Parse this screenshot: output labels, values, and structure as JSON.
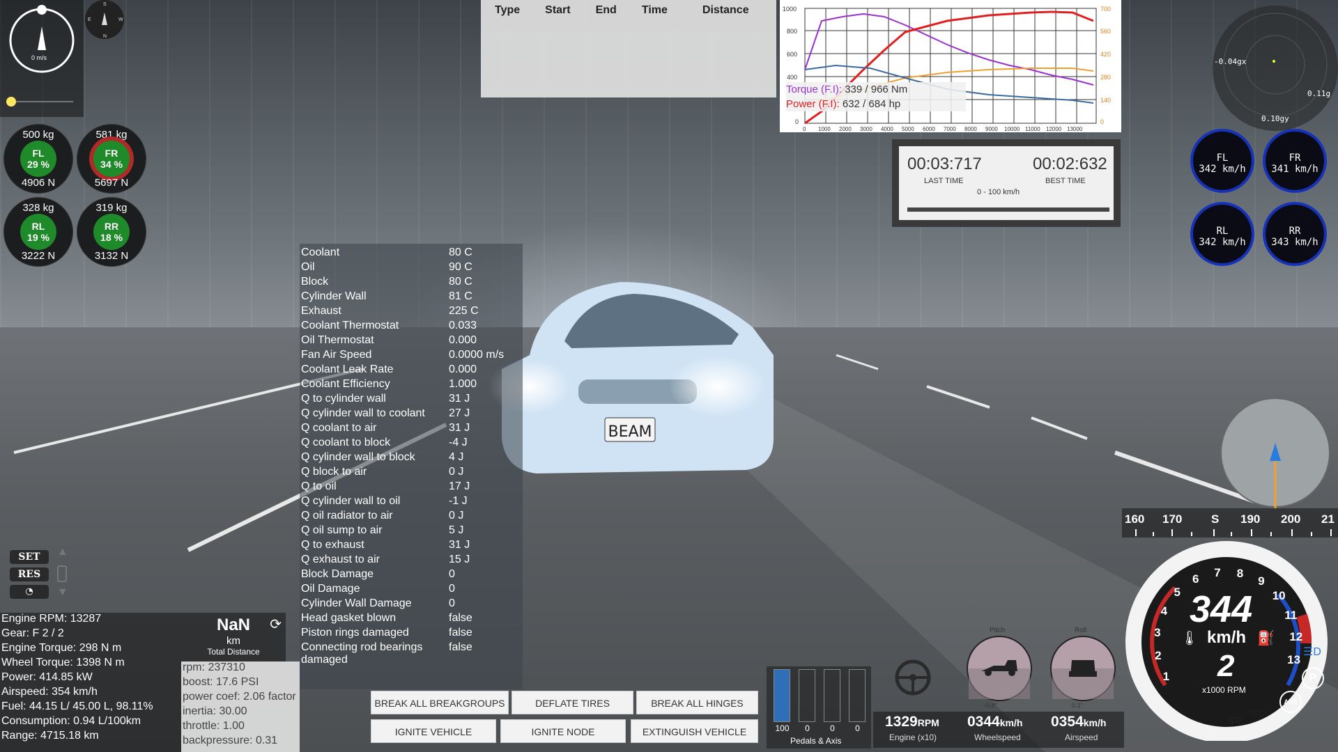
{
  "compass": {
    "speed": "0 m/s"
  },
  "tires": [
    {
      "id": "FL",
      "kg": "500 kg",
      "pct": "29 %",
      "n": "4906 N",
      "color": "#1f8a2a"
    },
    {
      "id": "FR",
      "kg": "581 kg",
      "pct": "34 %",
      "n": "5697 N",
      "color": "#c0302a"
    },
    {
      "id": "RL",
      "kg": "328 kg",
      "pct": "19 %",
      "n": "3222 N",
      "color": "#1f8a2a"
    },
    {
      "id": "RR",
      "kg": "319 kg",
      "pct": "18 %",
      "n": "3132 N",
      "color": "#1f8a2a"
    }
  ],
  "log": {
    "headers": [
      "Type",
      "Start",
      "End",
      "Time",
      "Distance"
    ]
  },
  "graph": {
    "torque_label": "Torque (F.I):",
    "torque_value": "339 / 966 Nm",
    "power_label": "Power (F.I):",
    "power_value": "632 / 684 hp",
    "left_ticks": [
      "1000",
      "800",
      "600",
      "400",
      "0"
    ],
    "right_ticks": [
      "700",
      "560",
      "420",
      "280",
      "140",
      "0"
    ],
    "x_ticks": [
      "0",
      "1000",
      "2000",
      "3000",
      "4000",
      "5000",
      "6000",
      "7000",
      "8000",
      "9000",
      "10000",
      "11000",
      "12000",
      "13000"
    ]
  },
  "timer": {
    "last": "00:03:717",
    "last_label": "LAST TIME",
    "best": "00:02:632",
    "best_label": "BEST TIME",
    "category": "0 - 100 km/h"
  },
  "gforce": {
    "x": "-0.04gx",
    "y": "0.10gy",
    "z": "0.11g"
  },
  "wheels": [
    {
      "id": "FL",
      "speed": "342 km/h"
    },
    {
      "id": "FR",
      "speed": "341 km/h"
    },
    {
      "id": "RL",
      "speed": "342 km/h"
    },
    {
      "id": "RR",
      "speed": "343 km/h"
    }
  ],
  "thermal": [
    [
      "Coolant",
      "80 C"
    ],
    [
      "Oil",
      "90 C"
    ],
    [
      "Block",
      "80 C"
    ],
    [
      "Cylinder Wall",
      "81 C"
    ],
    [
      "Exhaust",
      "225 C"
    ],
    [
      "Coolant Thermostat",
      "0.033"
    ],
    [
      "Oil Thermostat",
      "0.000"
    ],
    [
      "Fan Air Speed",
      "0.0000 m/s"
    ],
    [
      "Coolant Leak Rate",
      "0.000"
    ],
    [
      "Coolant Efficiency",
      "1.000"
    ],
    [
      "Q to cylinder wall",
      "31 J"
    ],
    [
      "Q cylinder wall to coolant",
      "27 J"
    ],
    [
      "Q coolant to air",
      "31 J"
    ],
    [
      "Q coolant to block",
      "-4 J"
    ],
    [
      "Q cylinder wall to block",
      "4 J"
    ],
    [
      "Q block to air",
      "0 J"
    ],
    [
      "Q to oil",
      "17 J"
    ],
    [
      "Q cylinder wall to oil",
      "-1 J"
    ],
    [
      "Q oil radiator to air",
      "0 J"
    ],
    [
      "Q oil sump to air",
      "5 J"
    ],
    [
      "Q to exhaust",
      "31 J"
    ],
    [
      "Q exhaust to air",
      "15 J"
    ],
    [
      "Block Damage",
      "0"
    ],
    [
      "Oil Damage",
      "0"
    ],
    [
      "Cylinder Wall Damage",
      "0"
    ],
    [
      "Head gasket blown",
      "false"
    ],
    [
      "Piston rings damaged",
      "false"
    ],
    [
      "Connecting rod bearings damaged",
      "false"
    ]
  ],
  "stats": [
    "Engine RPM: 13287",
    "Gear: F 2 / 2",
    "Engine Torque: 298 N m",
    "Wheel Torque: 1398 N m",
    "Power: 414.85 kW",
    "Airspeed: 354 km/h",
    "Fuel: 44.15 L/ 45.00 L, 98.11%",
    "Consumption: 0.94 L/100km",
    "Range: 4715.18 km"
  ],
  "distance": {
    "value": "NaN",
    "unit": "km",
    "label": "Total Distance"
  },
  "debug": [
    "rpm: 237310",
    "boost: 17.6 PSI",
    "power coef: 2.06 factor",
    "inertia: 30.00",
    "throttle: 1.00",
    "backpressure: 0.31"
  ],
  "cruise": {
    "set": "SET",
    "res": "RES"
  },
  "buttons": {
    "break_breakgroups": "BREAK ALL BREAKGROUPS",
    "deflate_tires": "DEFLATE TIRES",
    "break_hinges": "BREAK ALL HINGES",
    "ignite_vehicle": "IGNITE VEHICLE",
    "ignite_node": "IGNITE NODE",
    "extinguish": "EXTINGUISH VEHICLE"
  },
  "pedals": {
    "values": [
      "100",
      "0",
      "0",
      "0"
    ],
    "levels": [
      1.0,
      0,
      0,
      0
    ],
    "label": "Pedals & Axis"
  },
  "bottom_stats": {
    "rpm": "1329",
    "rpm_unit": "RPM",
    "rpm_label": "Engine (x10)",
    "wheel": "0344",
    "wheel_unit": "km/h",
    "wheel_label": "Wheelspeed",
    "air": "0354",
    "air_unit": "km/h",
    "air_label": "Airspeed",
    "pitch_label": "Pitch",
    "roll_label": "Roll",
    "pitch_value": "-0.8°",
    "roll_value": "0.1°"
  },
  "heading": {
    "labels": [
      "160",
      "170",
      "S",
      "190",
      "200",
      "21"
    ]
  },
  "gauge": {
    "speed": "344",
    "unit": "km/h",
    "gear": "2",
    "rpm_label": "x1000 RPM",
    "ticks": [
      "1",
      "2",
      "3",
      "4",
      "5",
      "6",
      "7",
      "8",
      "9",
      "10",
      "11",
      "12",
      "13"
    ],
    "abs": "ABS",
    "park": "P"
  },
  "colors": {
    "torque": "#9b2fd0",
    "power": "#e02020",
    "orange": "#f0a030",
    "blue": "#3a6aa0",
    "gauge_red": "#c62828",
    "gauge_blue": "#1e4fc8"
  }
}
